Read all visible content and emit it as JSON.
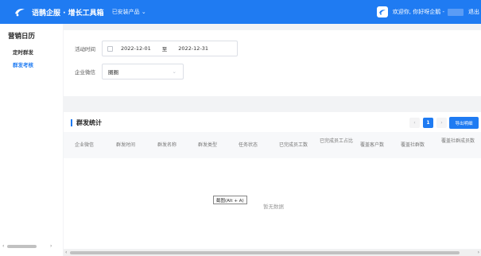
{
  "topbar": {
    "brand": "语鹊企服 · 增长工具箱",
    "installed_products": "已安装产品",
    "welcome": "欢迎你, 你好呀企鹅 -",
    "logout": "退出"
  },
  "sidebar": {
    "title": "营销日历",
    "items": [
      {
        "label": "定时群发"
      },
      {
        "label": "群发考核"
      }
    ]
  },
  "filters": {
    "activity_time_label": "活动时间",
    "start_date": "2022-12-01",
    "range_sep": "至",
    "end_date": "2022-12-31",
    "wecom_label": "企业微信",
    "wecom_value": "圈圈"
  },
  "stats": {
    "title": "群发统计",
    "current_page": "1",
    "prev": "‹",
    "next": "›",
    "export_label": "导出明细",
    "columns": [
      "企业微信",
      "群发时间",
      "群发名称",
      "群发类型",
      "任务状态",
      "已完成员工数",
      "已完成员工占比",
      "覆盖客户数",
      "覆盖社群数",
      "覆盖社群成员数"
    ],
    "empty": "暂无数据"
  },
  "tooltip": "截图(Alt + A)",
  "colors": {
    "accent": "#1f7bf2"
  }
}
